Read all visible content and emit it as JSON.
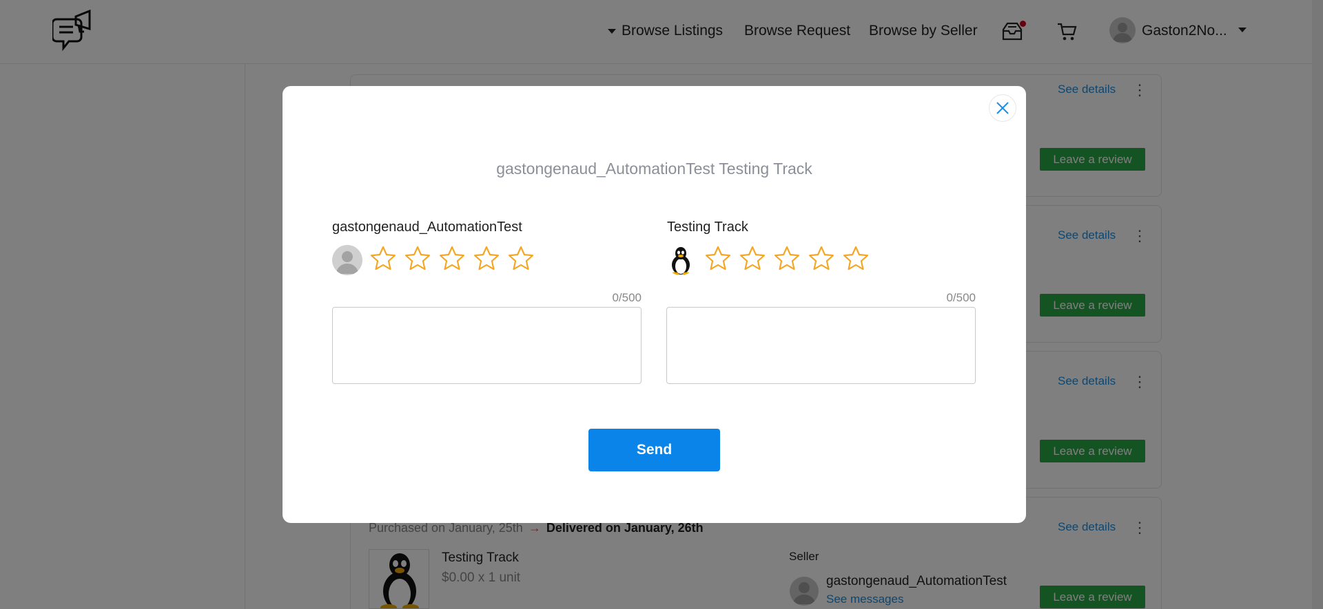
{
  "header": {
    "nav": {
      "browse_listings": "Browse Listings",
      "browse_request": "Browse Request",
      "browse_by_seller": "Browse by Seller"
    },
    "user": {
      "name": "Gaston2No..."
    },
    "icons": {
      "logo": "chat-megaphone-logo",
      "inbox": "inbox-icon",
      "cart": "cart-icon",
      "notification_dot_color": "#d0021b"
    }
  },
  "orders": {
    "cards": [
      {
        "see_details": "See details",
        "review_label": "Leave a review"
      },
      {
        "see_details": "See details",
        "review_label": "Leave a review"
      },
      {
        "see_details": "See details",
        "review_label": "Leave a review"
      },
      {
        "see_details": "See details",
        "review_label": "Leave a review",
        "purchased": "Purchased on January, 25th",
        "delivered": "Delivered on January, 26th",
        "product_title": "Testing Track",
        "product_price": "$0.00 x 1 unit",
        "seller_label": "Seller",
        "seller_name": "gastongenaud_AutomationTest",
        "see_messages": "See messages"
      }
    ]
  },
  "modal": {
    "title": "gastongenaud_AutomationTest Testing Track",
    "seller": {
      "label": "gastongenaud_AutomationTest",
      "rating": 0,
      "max_rating": 5,
      "counter": "0/500",
      "text": ""
    },
    "product": {
      "label": "Testing Track",
      "rating": 0,
      "max_rating": 5,
      "counter": "0/500",
      "text": ""
    },
    "send_label": "Send"
  },
  "colors": {
    "accent_blue": "#0a84e8",
    "review_green": "#28a745",
    "star_outline": "#f5a623",
    "link_blue": "#1a8fe3"
  }
}
